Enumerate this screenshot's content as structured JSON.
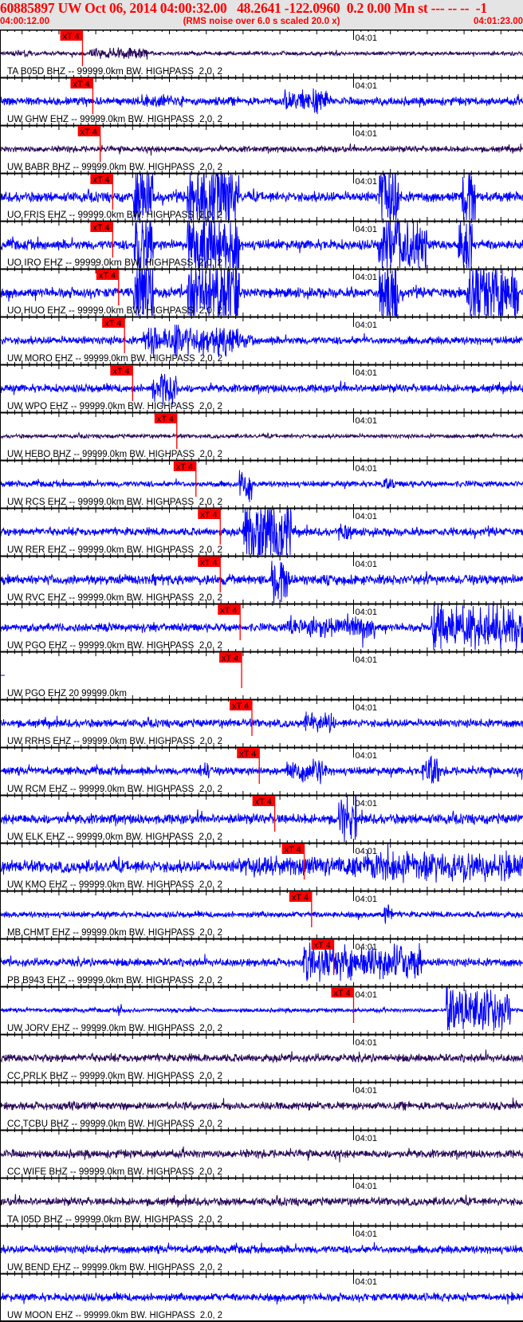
{
  "header": {
    "title": "60885897 UW Oct 06, 2014 04:00:32.00   48.2641 -122.0960  0.2 0.00 Mn st --- -- --  -1",
    "start_time": "04:00:12.00",
    "note": "(RMS noise over 6.0 s scaled 20.0 x)",
    "end_time": "04:01:23.00"
  },
  "colors": {
    "header_text": "#ff0000",
    "header_bg": "#e4e4e4",
    "trace_ehz": "#0000ff",
    "trace_bhz": "#2a0a5a",
    "pick": "#ff0000"
  },
  "chart_data": {
    "type": "line",
    "title": "",
    "x_range_s": [
      0,
      71
    ],
    "minute_label": "04:01",
    "minute_label_s": 48,
    "pick_label": "xT 4",
    "traces": [
      {
        "label": "TA B05D BHZ -- 99999.0km BW. HIGHPASS  2.0, 2",
        "channel": "BHZ",
        "pick_s": 11.2
      },
      {
        "label": "UW GHW EHZ -- 99999.0km BW. HIGHPASS  2.0, 2",
        "channel": "EHZ",
        "pick_s": 12.6
      },
      {
        "label": "UW BABR BHZ -- 99999.0km BW. HIGHPASS  2.0, 2",
        "channel": "BHZ",
        "pick_s": 13.6
      },
      {
        "label": "UO FRIS EHZ -- 99999.0km BW. HIGHPASS  2.0, 2",
        "channel": "EHZ",
        "pick_s": 15.3
      },
      {
        "label": "UO IRO EHZ -- 99999.0km BW. HIGHPASS  2.0, 2",
        "channel": "EHZ",
        "pick_s": 15.3
      },
      {
        "label": "UO HUO EHZ -- 99999.0km BW. HIGHPASS  2.0, 2",
        "channel": "EHZ",
        "pick_s": 16.1
      },
      {
        "label": "UW MORO EHZ -- 99999.0km BW. HIGHPASS  2.0, 2",
        "channel": "EHZ",
        "pick_s": 16.9
      },
      {
        "label": "UW WPO EHZ -- 99999.0km BW. HIGHPASS  2.0, 2",
        "channel": "EHZ",
        "pick_s": 18.0
      },
      {
        "label": "UW HEBO BHZ -- 99999.0km BW. HIGHPASS  2.0, 2",
        "channel": "BHZ",
        "pick_s": 24.0
      },
      {
        "label": "UW RCS EHZ -- 99999.0km BW. HIGHPASS  2.0, 2",
        "channel": "EHZ",
        "pick_s": 26.6
      },
      {
        "label": "UW RER EHZ -- 99999.0km BW. HIGHPASS  2.0, 2",
        "channel": "EHZ",
        "pick_s": 29.9
      },
      {
        "label": "UW RVC EHZ -- 99999.0km BW. HIGHPASS  2.0, 2",
        "channel": "EHZ",
        "pick_s": 29.9
      },
      {
        "label": "UW PGO EHZ -- 99999.0km BW. HIGHPASS  2.0, 2",
        "channel": "EHZ",
        "pick_s": 32.6
      },
      {
        "label": "UW PGO EHZ 20 99999.0km",
        "channel": "EHZ",
        "pick_s": 32.8
      },
      {
        "label": "UW RRHS EHZ -- 99999.0km BW. HIGHPASS  2.0, 2",
        "channel": "EHZ",
        "pick_s": 34.2
      },
      {
        "label": "UW RCM EHZ -- 99999.0km BW. HIGHPASS  2.0, 2",
        "channel": "EHZ",
        "pick_s": 35.2
      },
      {
        "label": "UW ELK EHZ -- 99999.0km BW. HIGHPASS  2.0, 2",
        "channel": "EHZ",
        "pick_s": 37.3
      },
      {
        "label": "UW KMO EHZ -- 99999.0km BW. HIGHPASS  2.0, 2",
        "channel": "EHZ",
        "pick_s": 41.3
      },
      {
        "label": "MB CHMT EHZ -- 99999.0km BW. HIGHPASS  2.0, 2",
        "channel": "EHZ",
        "pick_s": 42.3
      },
      {
        "label": "PB B943 EHZ -- 99999.0km BW. HIGHPASS  2.0, 2",
        "channel": "EHZ",
        "pick_s": 45.3
      },
      {
        "label": "UW JORV EHZ -- 99999.0km BW. HIGHPASS  2.0, 2",
        "channel": "EHZ",
        "pick_s": 48.0
      },
      {
        "label": "CC PRLK BHZ -- 99999.0km BW. HIGHPASS  2.0, 2",
        "channel": "BHZ",
        "pick_s": null
      },
      {
        "label": "CC TCBU BHZ -- 99999.0km BW. HIGHPASS  2.0, 2",
        "channel": "BHZ",
        "pick_s": null
      },
      {
        "label": "CC WIFE BHZ -- 99999.0km BW. HIGHPASS  2.0, 2",
        "channel": "BHZ",
        "pick_s": null
      },
      {
        "label": "TA I05D BHZ -- 99999.0km BW. HIGHPASS  2.0, 2",
        "channel": "BHZ",
        "pick_s": null
      },
      {
        "label": "UW BEND EHZ -- 99999.0km BW. HIGHPASS  2.0, 2",
        "channel": "EHZ",
        "pick_s": null
      },
      {
        "label": "UW MOON EHZ -- 99999.0km BW. HIGHPASS  2.0, 2",
        "channel": "EHZ",
        "pick_s": null
      }
    ]
  }
}
